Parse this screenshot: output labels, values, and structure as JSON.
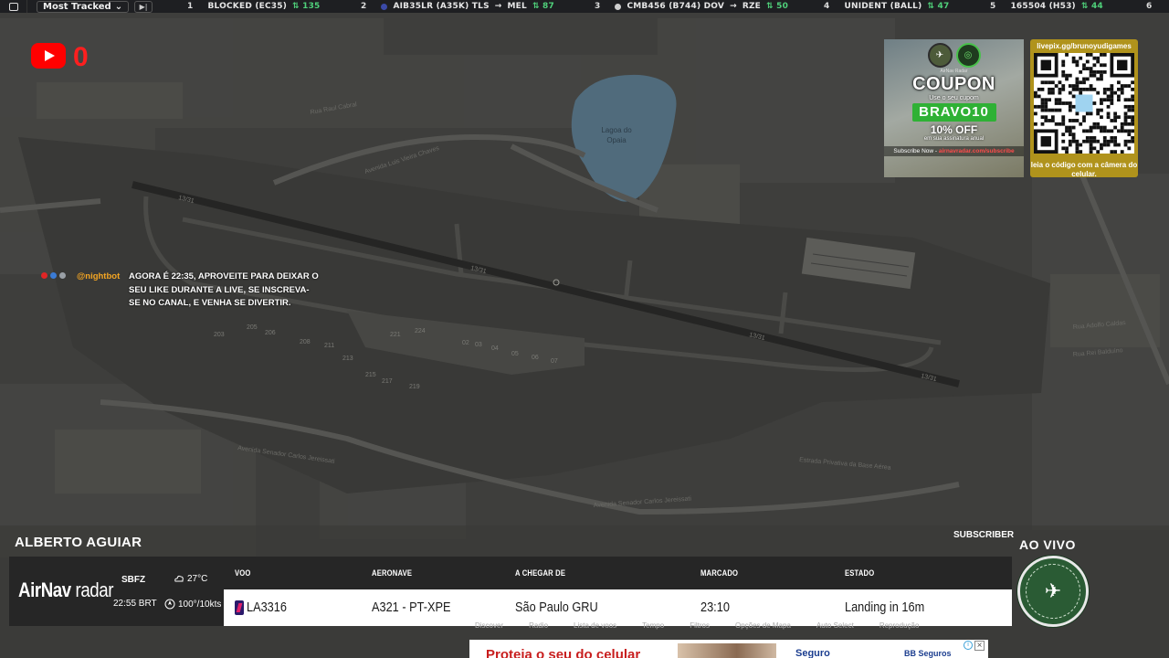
{
  "topbar": {
    "dropdown_label": "Most Tracked",
    "entries": [
      {
        "rank": "1",
        "flight": "BLOCKED (EC35)",
        "route": "",
        "count": "135",
        "dot": ""
      },
      {
        "rank": "2",
        "flight": "AIB35LR (A35K) TLS",
        "route": "MEL",
        "count": "87",
        "dot": "#3b4aa8"
      },
      {
        "rank": "3",
        "flight": "CMB456 (B744) DOV",
        "route": "RZE",
        "count": "50",
        "dot": "#cfcfcf"
      },
      {
        "rank": "4",
        "flight": "UNIDENT (BALL)",
        "route": "",
        "count": "47",
        "dot": ""
      },
      {
        "rank": "5",
        "flight": "165504 (H53)",
        "route": "",
        "count": "44",
        "dot": ""
      },
      {
        "rank": "6",
        "flight": "",
        "route": "",
        "count": "",
        "dot": ""
      }
    ]
  },
  "youtube": {
    "count": "0"
  },
  "chat": {
    "user": "@nightbot",
    "message": "AGORA É 22:35, APROVEITE PARA DEIXAR O SEU LIKE DURANTE A LIVE, SE INSCREVA-SE NO CANAL, E VENHA SE DIVERTIR."
  },
  "map": {
    "lake_label_1": "Lagoa do",
    "lake_label_2": "Opaia",
    "roads": [
      "Avenida Luis Vieira Chaves",
      "Avenida Senador Carlos Jereissati",
      "Avenida Senador Carlos Jereissati",
      "Estrada Privativa da Base Aérea",
      "Rua Raul Cabral",
      "Rua Adolfo Caldas",
      "Rua Rei Balduíno"
    ],
    "runway_labels": [
      "13/31",
      "13/31",
      "13/31",
      "13/31"
    ],
    "stands": [
      "205",
      "206",
      "203",
      "208",
      "211",
      "213",
      "221",
      "224",
      "02",
      "03",
      "04",
      "05",
      "06",
      "07",
      "215",
      "217",
      "219"
    ]
  },
  "coupon": {
    "brand": "AirNav Radar",
    "title": "COUPON",
    "use_line": "Use o seu cupom",
    "code": "BRAVO10",
    "discount": "10% OFF",
    "fine_print": "em sua assinatura anual",
    "site_label": "Subscribe Now - ",
    "site_url": "airnavradar.com/subscribe"
  },
  "qr": {
    "url": "livepix.gg/brunoyudigames",
    "caption": "leia o código com a câmera do celular."
  },
  "lower": {
    "name": "ALBERTO AGUIAR",
    "subscriber": "SUBSCRIBER",
    "live": "AO VIVO",
    "airnav_a": "AirNav",
    "airnav_b": "radar",
    "icao": "SBFZ",
    "local_time": "22:55 BRT",
    "temperature": "27°C",
    "wind": "100°/10kts",
    "headers": {
      "flight": "VOO",
      "aircraft": "AERONAVE",
      "from": "A CHEGAR DE",
      "scheduled": "MARCADO",
      "status": "ESTADO"
    },
    "row": {
      "flight": "LA3316",
      "aircraft": "A321 - PT-XPE",
      "from": "São Paulo GRU",
      "scheduled": "23:10",
      "status": "Landing in 16m"
    }
  },
  "menubar": [
    "Discover",
    "Radio",
    "Lista de voos",
    "Tempo",
    "Filtros",
    "Opções de Mapa",
    "Auto Select",
    "Reprodução"
  ],
  "ad": {
    "headline": "Proteja o seu do celular",
    "brand": "Seguro",
    "bank": "BB Seguros"
  }
}
